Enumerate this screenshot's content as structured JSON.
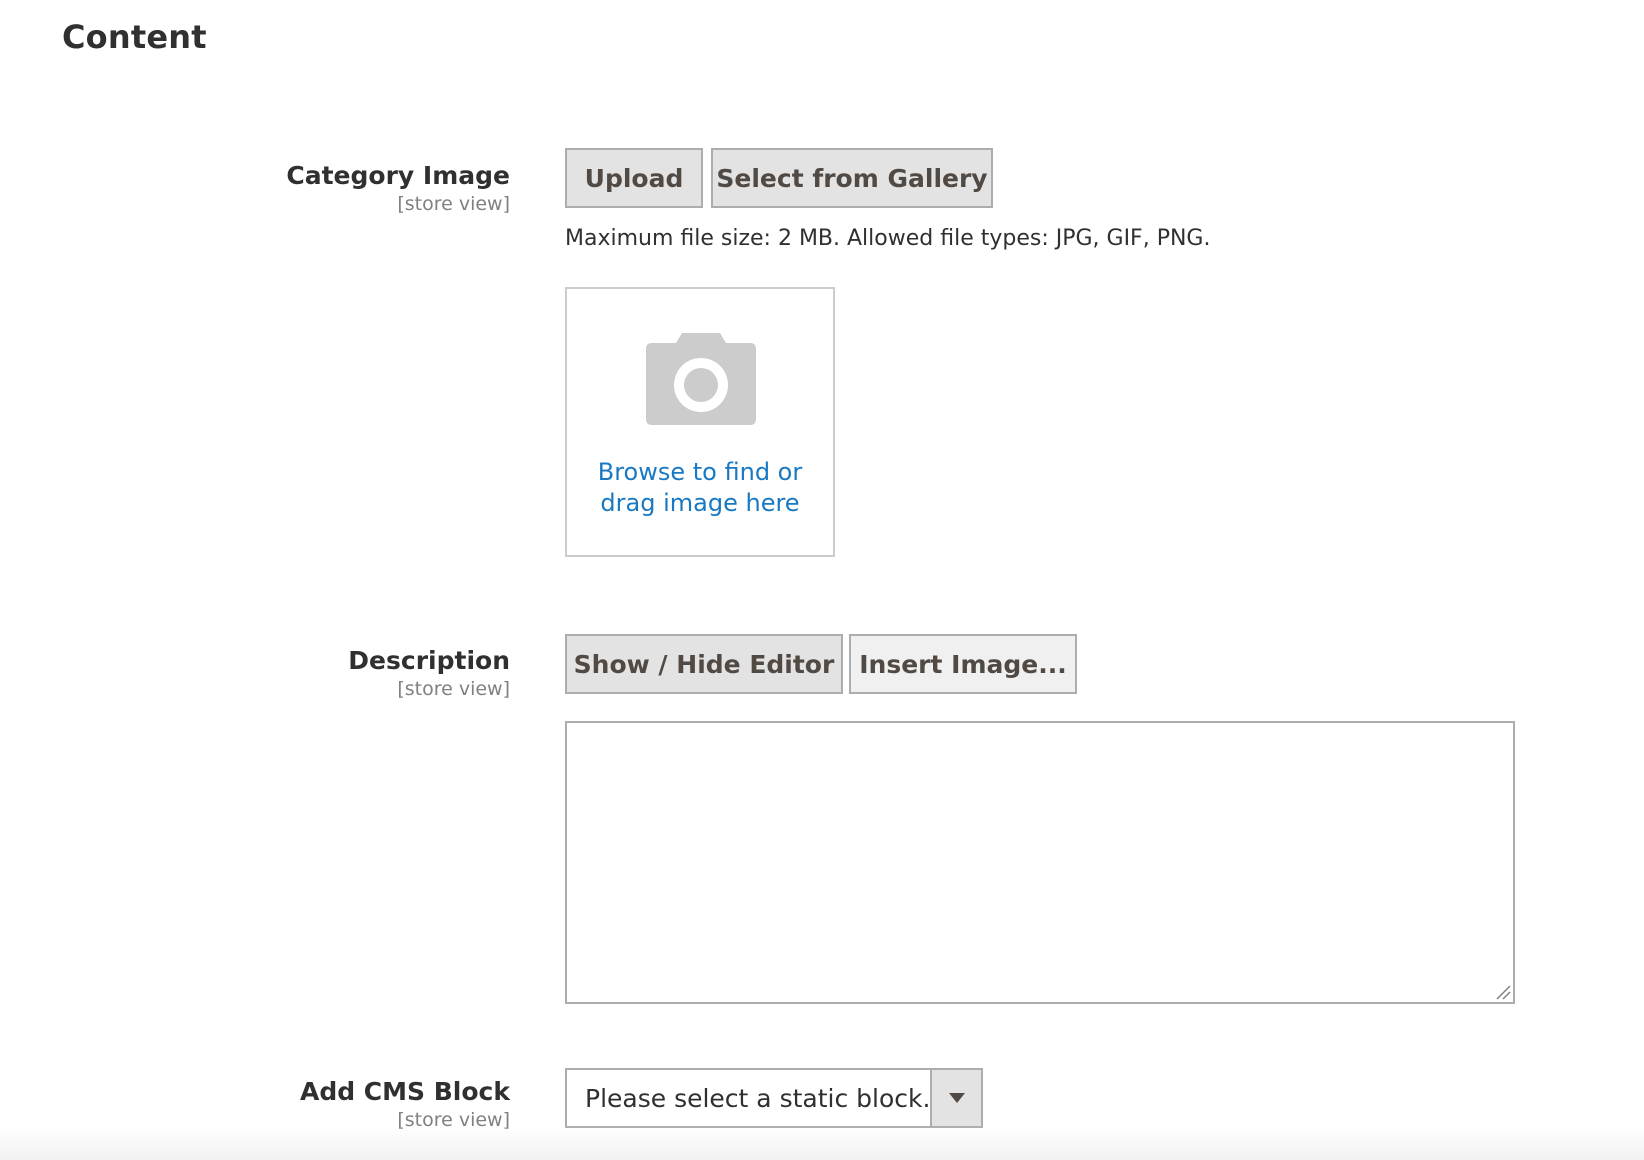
{
  "section": {
    "title": "Content"
  },
  "category_image": {
    "label": "Category Image",
    "scope": "[store view]",
    "upload_label": "Upload",
    "gallery_label": "Select from Gallery",
    "hint": "Maximum file size: 2 MB. Allowed file types: JPG, GIF, PNG.",
    "dropzone_icon": "camera-icon",
    "dropzone_line1": "Browse to find or",
    "dropzone_line2": "drag image here"
  },
  "description": {
    "label": "Description",
    "scope": "[store view]",
    "toggle_editor_label": "Show / Hide Editor",
    "insert_image_label": "Insert Image...",
    "value": ""
  },
  "cms_block": {
    "label": "Add CMS Block",
    "scope": "[store view]",
    "selected": "Please select a static block.",
    "arrow_icon": "caret-down-icon"
  },
  "colors": {
    "text": "#303030",
    "muted": "#808080",
    "link": "#1979c3",
    "button_bg": "#e3e3e3",
    "border": "#adadad",
    "icon_gray": "#cccccc"
  }
}
